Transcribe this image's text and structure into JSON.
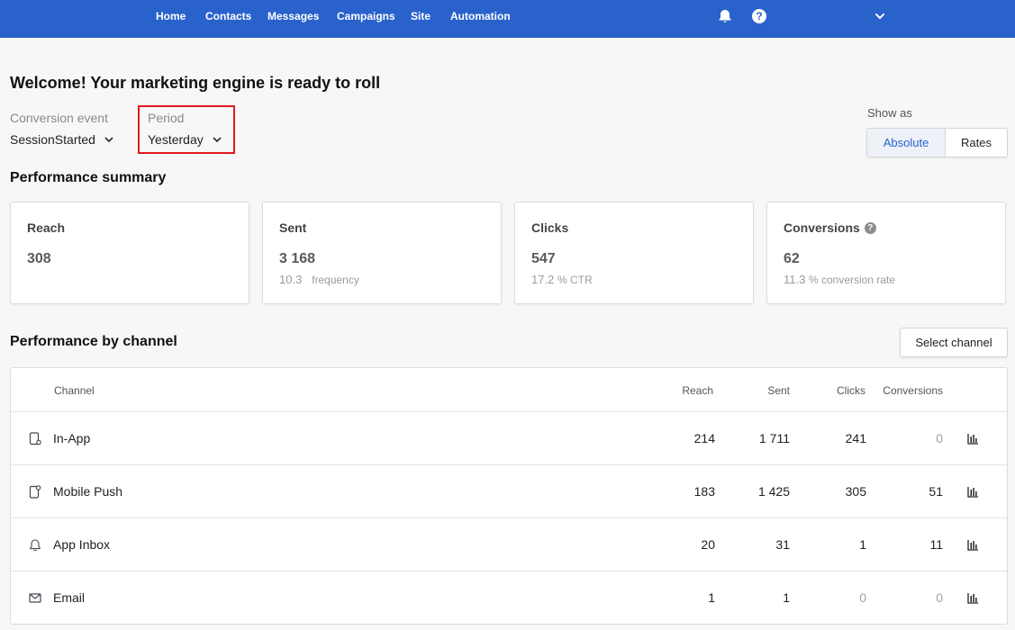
{
  "nav": {
    "items": [
      "Home",
      "Contacts",
      "Messages",
      "Campaigns",
      "Site",
      "Automation"
    ],
    "bell_icon": "bell-icon",
    "help_icon": "help-circle-icon",
    "menu_icon": "chevron-down-icon"
  },
  "page_title": "Welcome! Your marketing engine is ready to roll",
  "filters": {
    "conversion_event_label": "Conversion event",
    "conversion_event_value": "SessionStarted",
    "period_label": "Period",
    "period_value": "Yesterday"
  },
  "show_as": {
    "label": "Show as",
    "options": [
      "Absolute",
      "Rates"
    ],
    "selected": "Absolute"
  },
  "summary": {
    "heading": "Performance summary",
    "cards": [
      {
        "title": "Reach",
        "value": "308",
        "sub_value": "",
        "sub_unit": ""
      },
      {
        "title": "Sent",
        "value": "3 168",
        "sub_value": "10.3",
        "sub_unit": "frequency"
      },
      {
        "title": "Clicks",
        "value": "547",
        "sub_value": "17.2",
        "sub_unit": "% CTR"
      },
      {
        "title": "Conversions",
        "value": "62",
        "sub_value": "11.3",
        "sub_unit": "% conversion rate"
      }
    ]
  },
  "channels": {
    "heading": "Performance by channel",
    "select_button": "Select channel",
    "columns": [
      "Channel",
      "Reach",
      "Sent",
      "Clicks",
      "Conversions"
    ],
    "rows": [
      {
        "icon": "in-app-icon",
        "name": "In-App",
        "reach": "214",
        "sent": "1 711",
        "clicks": "241",
        "conversions": "0"
      },
      {
        "icon": "mobile-push-icon",
        "name": "Mobile Push",
        "reach": "183",
        "sent": "1 425",
        "clicks": "305",
        "conversions": "51"
      },
      {
        "icon": "bell-icon",
        "name": "App Inbox",
        "reach": "20",
        "sent": "31",
        "clicks": "1",
        "conversions": "11"
      },
      {
        "icon": "mail-icon",
        "name": "Email",
        "reach": "1",
        "sent": "1",
        "clicks": "0",
        "conversions": "0"
      }
    ]
  },
  "colors": {
    "brand": "#2a62cc",
    "highlight_border": "#e0191e"
  }
}
